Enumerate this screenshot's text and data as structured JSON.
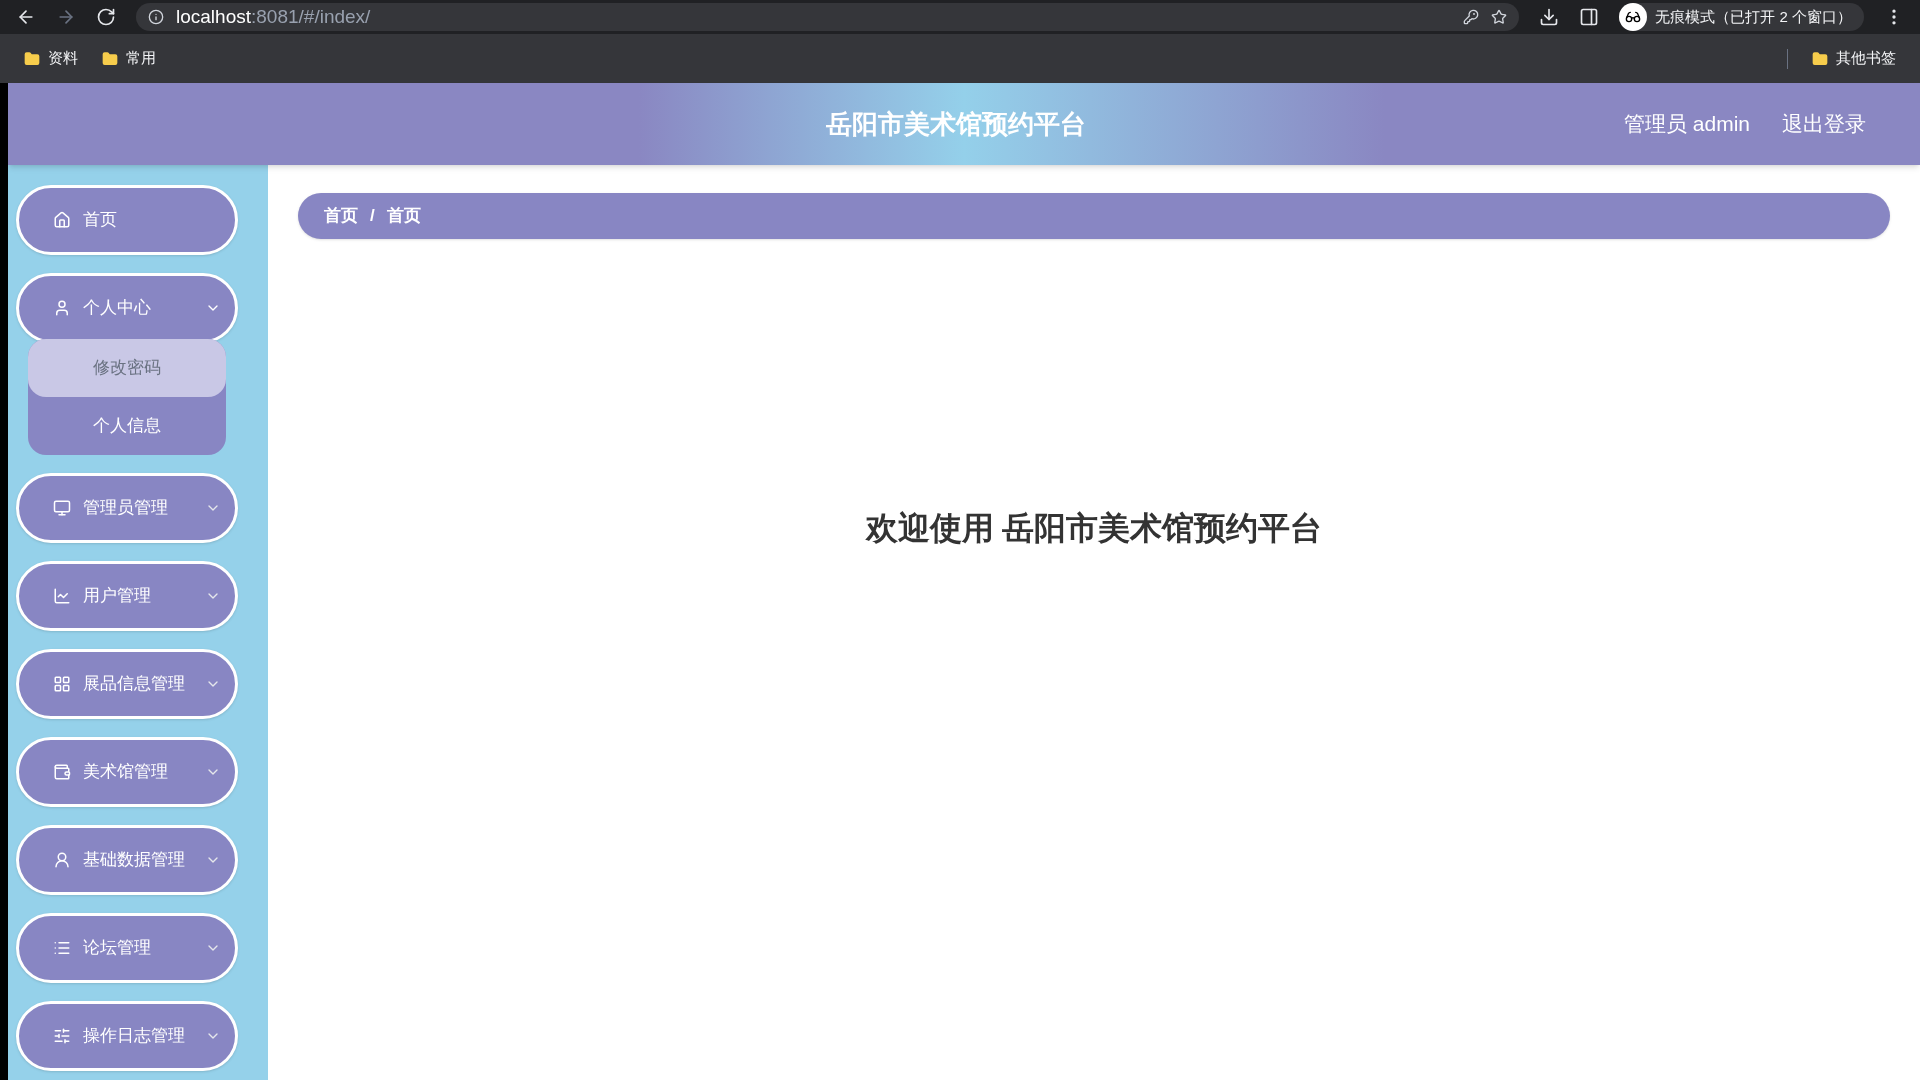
{
  "browser": {
    "url_host": "localhost",
    "url_path": ":8081/#/index/",
    "forward_disabled": true,
    "profile_label": "无痕模式（已打开 2 个窗口）",
    "bookmarks": [
      "资料",
      "常用"
    ],
    "other_bookmarks": "其他书签"
  },
  "header": {
    "title": "岳阳市美术馆预约平台",
    "user": "管理员 admin",
    "logout": "退出登录"
  },
  "sidebar": {
    "items": [
      {
        "label": "首页"
      },
      {
        "label": "个人中心",
        "expanded": true,
        "children": [
          {
            "label": "修改密码",
            "hovered": true
          },
          {
            "label": "个人信息",
            "hovered": false
          }
        ]
      },
      {
        "label": "管理员管理",
        "expanded": false
      },
      {
        "label": "用户管理",
        "expanded": false
      },
      {
        "label": "展品信息管理",
        "expanded": false
      },
      {
        "label": "美术馆管理",
        "expanded": false
      },
      {
        "label": "基础数据管理",
        "expanded": false
      },
      {
        "label": "论坛管理",
        "expanded": false
      },
      {
        "label": "操作日志管理",
        "expanded": false
      }
    ]
  },
  "breadcrumb": {
    "items": [
      "首页",
      "首页"
    ],
    "separator": "/"
  },
  "welcome": "欢迎使用 岳阳市美术馆预约平台"
}
